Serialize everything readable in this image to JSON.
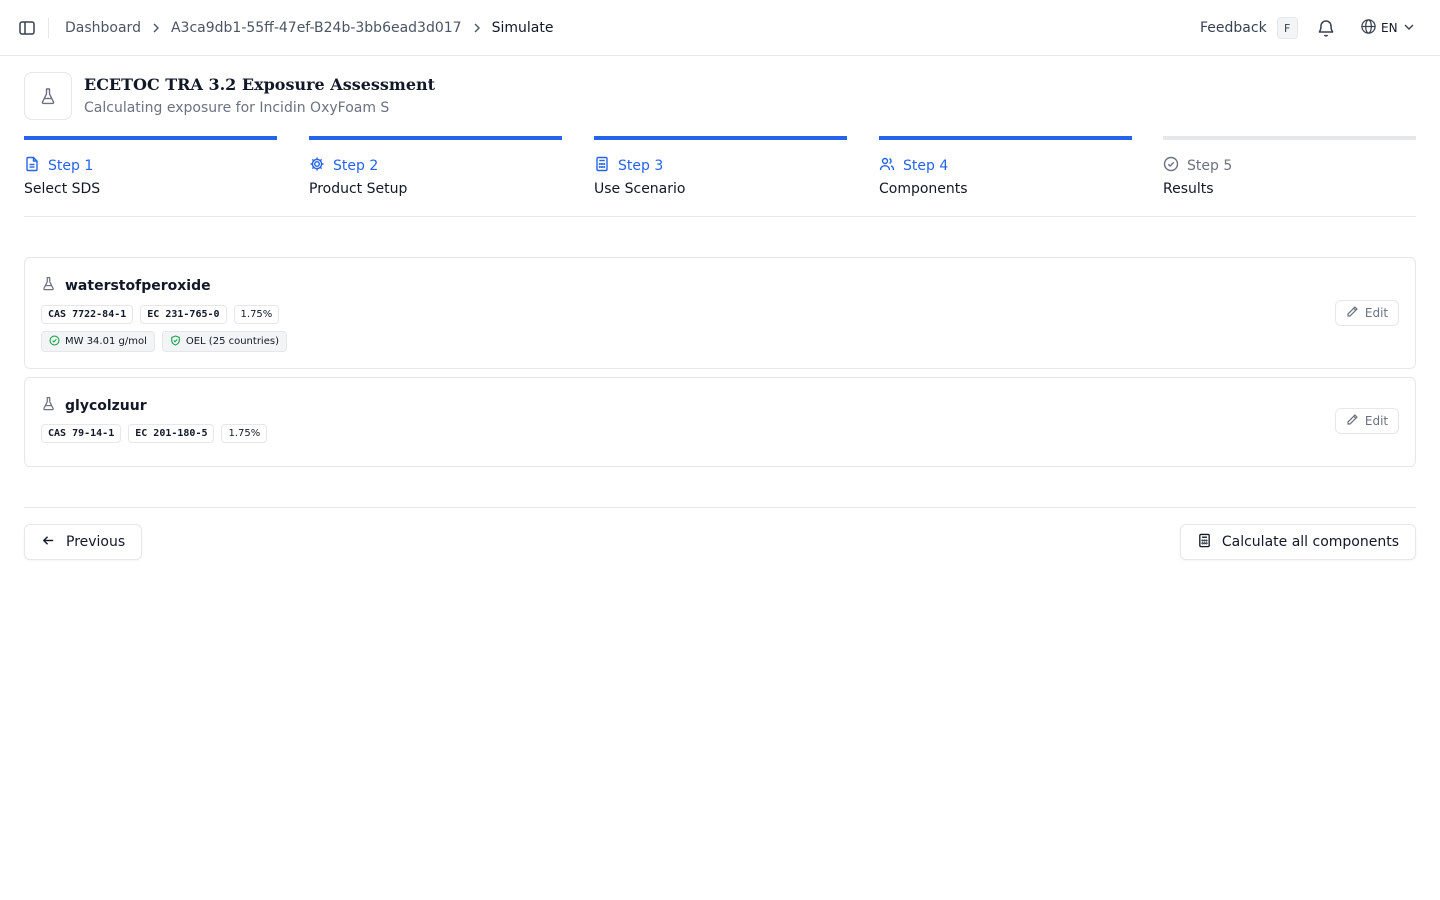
{
  "topbar": {
    "breadcrumb": [
      "Dashboard",
      "A3ca9db1-55ff-47ef-B24b-3bb6ead3d017",
      "Simulate"
    ],
    "feedback_label": "Feedback",
    "feedback_shortcut": "F",
    "language": "EN"
  },
  "header": {
    "title": "ECETOC TRA 3.2 Exposure Assessment",
    "subtitle": "Calculating exposure for Incidin OxyFoam S"
  },
  "steps": [
    {
      "label": "Step 1",
      "name": "Select SDS",
      "icon": "file-text-icon",
      "state": "complete"
    },
    {
      "label": "Step 2",
      "name": "Product Setup",
      "icon": "gear-icon",
      "state": "complete"
    },
    {
      "label": "Step 3",
      "name": "Use Scenario",
      "icon": "calculator-icon",
      "state": "complete"
    },
    {
      "label": "Step 4",
      "name": "Components",
      "icon": "users-icon",
      "state": "active"
    },
    {
      "label": "Step 5",
      "name": "Results",
      "icon": "check-circle-icon",
      "state": "pending"
    }
  ],
  "components": [
    {
      "name": "waterstofperoxide",
      "cas": "CAS 7722-84-1",
      "ec": "EC 231-765-0",
      "percent": "1.75%",
      "mw": "MW 34.01 g/mol",
      "oel": "OEL (25 countries)",
      "edit_label": "Edit"
    },
    {
      "name": "glycolzuur",
      "cas": "CAS 79-14-1",
      "ec": "EC 201-180-5",
      "percent": "1.75%",
      "edit_label": "Edit"
    }
  ],
  "actions": {
    "previous_label": "Previous",
    "calculate_label": "Calculate all components"
  },
  "colors": {
    "accent": "#2563eb",
    "success": "#16a34a",
    "border": "#e5e7eb",
    "muted_text": "#6b7280"
  }
}
